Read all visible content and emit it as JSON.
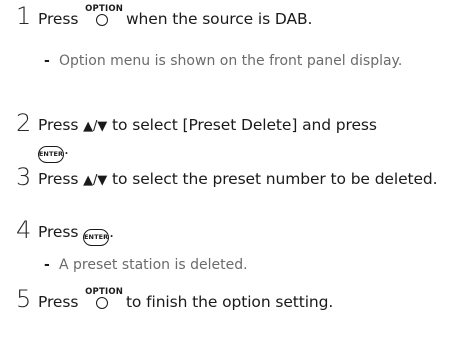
{
  "steps": [
    {
      "number": "1",
      "press": "Press",
      "text_after_button": "when the source is DAB.",
      "sub": "Option menu is shown on the front panel display."
    },
    {
      "number": "2",
      "press": "Press",
      "arrows": "▲/▼",
      "text_after_arrows": "to select [Preset Delete] and press"
    },
    {
      "number": "3",
      "press": "Press",
      "arrows": "▲/▼",
      "text_after_arrows": "to select the preset number to be deleted."
    },
    {
      "number": "4",
      "press": "Press",
      "sub": "A preset station is deleted."
    },
    {
      "number": "5",
      "press": "Press",
      "text_after_button": "to finish the option setting."
    }
  ],
  "buttons": {
    "option_label": "OPTION",
    "enter_label": "ENTER"
  },
  "sub_bullet": "-",
  "period": "."
}
